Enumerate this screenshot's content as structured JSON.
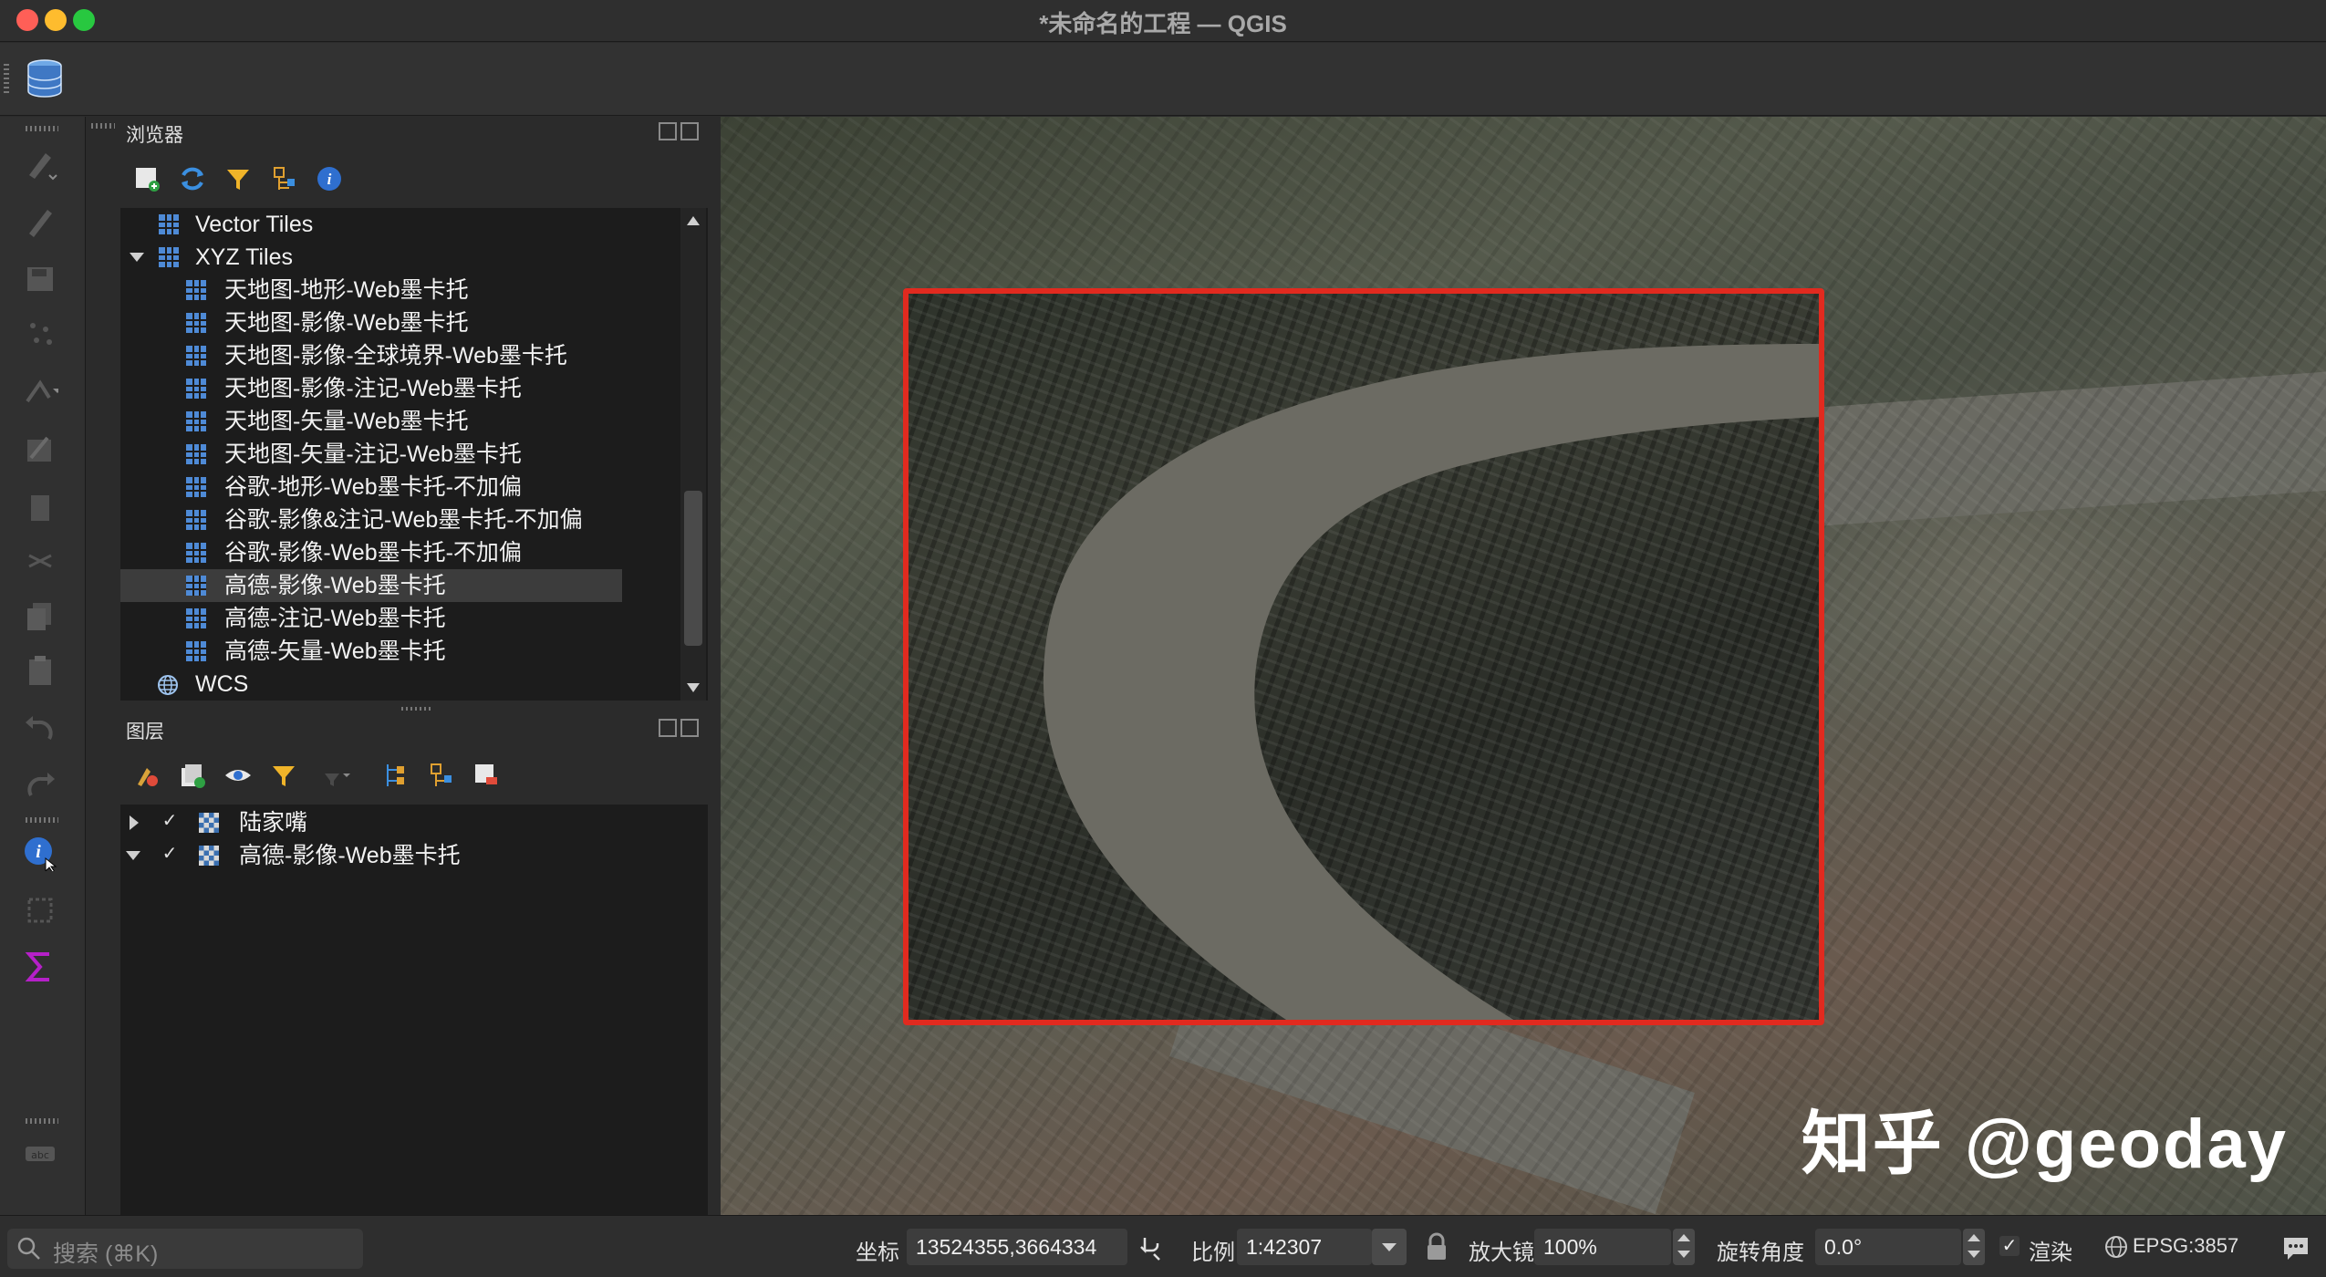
{
  "window": {
    "title": "*未命名的工程 — QGIS"
  },
  "browser_panel": {
    "title": "浏览器",
    "items": [
      {
        "label": "Vector Tiles",
        "level": 1,
        "expanded": null
      },
      {
        "label": "XYZ Tiles",
        "level": 1,
        "expanded": true
      },
      {
        "label": "天地图-地形-Web墨卡托",
        "level": 2
      },
      {
        "label": "天地图-影像-Web墨卡托",
        "level": 2
      },
      {
        "label": "天地图-影像-全球境界-Web墨卡托",
        "level": 2
      },
      {
        "label": "天地图-影像-注记-Web墨卡托",
        "level": 2
      },
      {
        "label": "天地图-矢量-Web墨卡托",
        "level": 2
      },
      {
        "label": "天地图-矢量-注记-Web墨卡托",
        "level": 2
      },
      {
        "label": "谷歌-地形-Web墨卡托-不加偏",
        "level": 2
      },
      {
        "label": "谷歌-影像&注记-Web墨卡托-不加偏",
        "level": 2
      },
      {
        "label": "谷歌-影像-Web墨卡托-不加偏",
        "level": 2
      },
      {
        "label": "高德-影像-Web墨卡托",
        "level": 2,
        "selected": true
      },
      {
        "label": "高德-注记-Web墨卡托",
        "level": 2
      },
      {
        "label": "高德-矢量-Web墨卡托",
        "level": 2
      },
      {
        "label": "WCS",
        "level": 1
      }
    ]
  },
  "layers_panel": {
    "title": "图层",
    "layers": [
      {
        "label": "陆家嘴",
        "checked": true,
        "expanded": false
      },
      {
        "label": "高德-影像-Web墨卡托",
        "checked": true,
        "expanded": true
      }
    ]
  },
  "map": {
    "watermark": "知乎 @geoday",
    "highlight_color": "#e12a1f"
  },
  "statusbar": {
    "search_placeholder": "搜索 (⌘K)",
    "coord_label": "坐标",
    "coord_value": "13524355,3664334",
    "scale_label": "比例",
    "scale_value": "1:42307",
    "magnifier_label": "放大镜",
    "magnifier_value": "100%",
    "rotation_label": "旋转角度",
    "rotation_value": "0.0°",
    "render_label": "渲染",
    "render_checked": true,
    "crs": "EPSG:3857"
  }
}
